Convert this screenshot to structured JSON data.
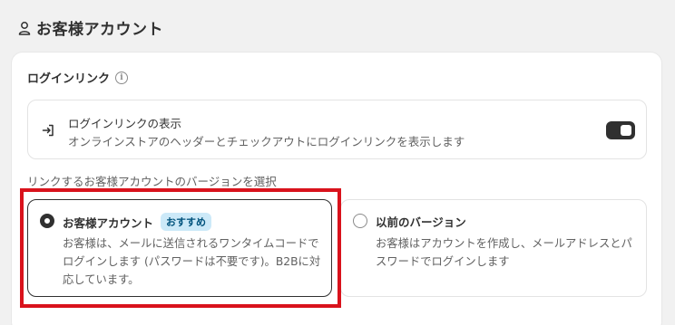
{
  "header": {
    "title": "お客様アカウント",
    "icon": "person-icon"
  },
  "section": {
    "title": "ログインリンク",
    "info_icon": "info-icon"
  },
  "login_link": {
    "title": "ログインリンクの表示",
    "description": "オンラインストアのヘッダーとチェックアウトにログインリンクを表示します",
    "icon": "login-arrow-icon",
    "toggle_on": true
  },
  "version_select": {
    "label": "リンクするお客様アカウントのバージョンを選択",
    "options": [
      {
        "title": "お客様アカウント",
        "badge": "おすすめ",
        "description": "お客様は、メールに送信されるワンタイムコードでログインします (パスワードは不要です)。B2Bに対応しています。",
        "selected": true
      },
      {
        "title": "以前のバージョン",
        "description": "お客様はアカウントを作成し、メールアドレスとパスワードでログインします",
        "selected": false
      }
    ]
  },
  "colors": {
    "highlight": "#d9121c",
    "badge_bg": "#cce9f8",
    "badge_text": "#00527c"
  }
}
